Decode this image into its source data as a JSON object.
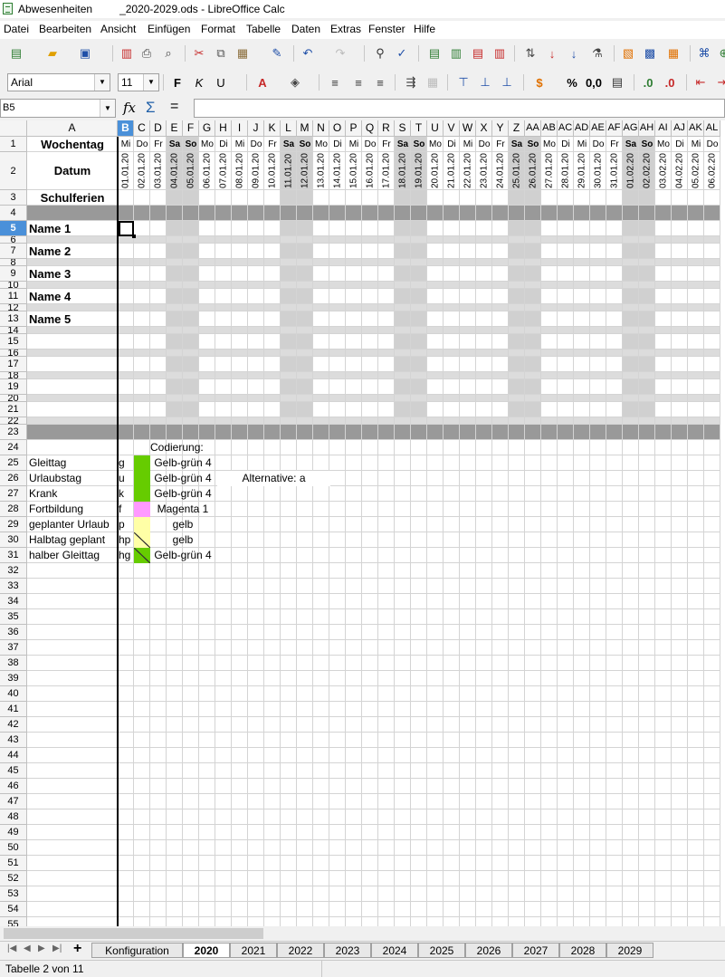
{
  "window": {
    "title": "Abwesenheiten         _2020-2029.ods - LibreOffice Calc"
  },
  "menu": [
    "Datei",
    "Bearbeiten",
    "Ansicht",
    "Einfügen",
    "Format",
    "Tabelle",
    "Daten",
    "Extras",
    "Fenster",
    "Hilfe"
  ],
  "toolbar": {
    "font_name": "Arial",
    "font_size": "11",
    "number_format_labels": [
      "%",
      "0,0"
    ]
  },
  "formula_bar": {
    "cell_ref": "B5",
    "formula": ""
  },
  "columns": [
    "A",
    "B",
    "C",
    "D",
    "E",
    "F",
    "G",
    "H",
    "I",
    "J",
    "K",
    "L",
    "M",
    "N",
    "O",
    "P",
    "Q",
    "R",
    "S",
    "T",
    "U",
    "V",
    "W",
    "X",
    "Y",
    "Z",
    "AA",
    "AB",
    "AC",
    "AD",
    "AE",
    "AF",
    "AG",
    "AH",
    "AI",
    "AJ",
    "AK",
    "AL"
  ],
  "selected_column": "B",
  "selected_row": "5",
  "rows_header": {
    "wochentag": "Wochentag",
    "datum": "Datum",
    "schulferien": "Schulferien"
  },
  "weekdays": [
    "Mi",
    "Do",
    "Fr",
    "Sa",
    "So",
    "Mo",
    "Di",
    "Mi",
    "Do",
    "Fr",
    "Sa",
    "So",
    "Mo",
    "Di",
    "Mi",
    "Do",
    "Fr",
    "Sa",
    "So",
    "Mo",
    "Di",
    "Mi",
    "Do",
    "Fr",
    "Sa",
    "So",
    "Mo",
    "Di",
    "Mi",
    "Do",
    "Fr",
    "Sa",
    "So",
    "Mo",
    "Di",
    "Mi",
    "Do"
  ],
  "dates": [
    "01.01.20",
    "02.01.20",
    "03.01.20",
    "04.01.20",
    "05.01.20",
    "06.01.20",
    "07.01.20",
    "08.01.20",
    "09.01.20",
    "10.01.20",
    "11.01.20",
    "12.01.20",
    "13.01.20",
    "14.01.20",
    "15.01.20",
    "16.01.20",
    "17.01.20",
    "18.01.20",
    "19.01.20",
    "20.01.20",
    "21.01.20",
    "22.01.20",
    "23.01.20",
    "24.01.20",
    "25.01.20",
    "26.01.20",
    "27.01.20",
    "28.01.20",
    "29.01.20",
    "30.01.20",
    "31.01.20",
    "01.02.20",
    "02.02.20",
    "03.02.20",
    "04.02.20",
    "05.02.20",
    "06.02.20"
  ],
  "names": [
    "Name 1",
    "Name 2",
    "Name 3",
    "Name 4",
    "Name 5"
  ],
  "legend": {
    "heading": "Codierung:",
    "alternative": "Alternative: a",
    "items": [
      {
        "label": "Gleittag",
        "code": "g",
        "color_name": "Gelb-grün 4",
        "color": "#66cc00"
      },
      {
        "label": "Urlaubstag",
        "code": "u",
        "color_name": "Gelb-grün 4",
        "color": "#66cc00"
      },
      {
        "label": "Krank",
        "code": "k",
        "color_name": "Gelb-grün 4",
        "color": "#66cc00"
      },
      {
        "label": "Fortbildung",
        "code": "f",
        "color_name": "Magenta 1",
        "color": "#ff99ff"
      },
      {
        "label": "geplanter Urlaub",
        "code": "p",
        "color_name": "gelb",
        "color": "#ffffa6"
      },
      {
        "label": "Halbtag geplant",
        "code": "hp",
        "color_name": "gelb",
        "color": "#ffffa6"
      },
      {
        "label": "halber Gleittag",
        "code": "hg",
        "color_name": "Gelb-grün 4",
        "color": "#66cc00"
      }
    ]
  },
  "sheet_tabs": [
    "Konfiguration",
    "2020",
    "2021",
    "2022",
    "2023",
    "2024",
    "2025",
    "2026",
    "2027",
    "2028",
    "2029"
  ],
  "active_tab": "2020",
  "status": {
    "sheet_info": "Tabelle 2 von 11"
  },
  "colors": {
    "weekend": "#d0d0d0",
    "separator": "#999999",
    "selection": "#4a90d9"
  }
}
